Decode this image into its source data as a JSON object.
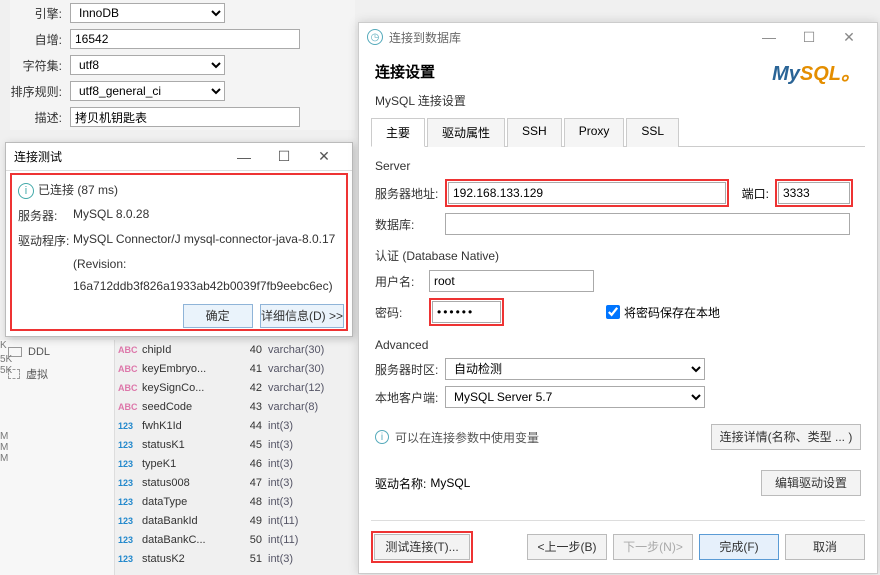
{
  "props": {
    "engine_lbl": "引擎:",
    "engine_val": "InnoDB",
    "auto_lbl": "自增:",
    "auto_val": "16542",
    "charset_lbl": "字符集:",
    "charset_val": "utf8",
    "collation_lbl": "排序规则:",
    "collation_val": "utf8_general_ci",
    "desc_lbl": "描述:",
    "desc_val": "拷贝机钥匙表"
  },
  "test_dialog": {
    "title": "连接测试",
    "connected": "已连接 (87 ms)",
    "server_lbl": "服务器:",
    "server_val": "MySQL 8.0.28",
    "driver_lbl": "驱动程序:",
    "driver_val": "MySQL Connector/J mysql-connector-java-8.0.17",
    "revision_lbl": "(Revision:",
    "revision_val": "16a712ddb3f826a1933ab42b0039f7fb9eebc6ec)",
    "ok_btn": "确定",
    "details_btn": "详细信息(D) >>"
  },
  "side": {
    "ddl_lbl": "DDL",
    "virt_lbl": "虚拟"
  },
  "cols": [
    {
      "icon": "abc",
      "name": "chipId",
      "idx": "40",
      "type": "varchar(30)"
    },
    {
      "icon": "abc",
      "name": "keyEmbryo...",
      "idx": "41",
      "type": "varchar(30)"
    },
    {
      "icon": "abc",
      "name": "keySignCo...",
      "idx": "42",
      "type": "varchar(12)"
    },
    {
      "icon": "abc",
      "name": "seedCode",
      "idx": "43",
      "type": "varchar(8)"
    },
    {
      "icon": "123",
      "name": "fwhK1Id",
      "idx": "44",
      "type": "int(3)"
    },
    {
      "icon": "123",
      "name": "statusK1",
      "idx": "45",
      "type": "int(3)"
    },
    {
      "icon": "123",
      "name": "typeK1",
      "idx": "46",
      "type": "int(3)"
    },
    {
      "icon": "123",
      "name": "status008",
      "idx": "47",
      "type": "int(3)"
    },
    {
      "icon": "123",
      "name": "dataType",
      "idx": "48",
      "type": "int(3)"
    },
    {
      "icon": "123",
      "name": "dataBankId",
      "idx": "49",
      "type": "int(11)"
    },
    {
      "icon": "123",
      "name": "dataBankC...",
      "idx": "50",
      "type": "int(11)"
    },
    {
      "icon": "123",
      "name": "statusK2",
      "idx": "51",
      "type": "int(3)"
    }
  ],
  "conn": {
    "win_title": "连接到数据库",
    "heading": "连接设置",
    "sub": "MySQL 连接设置",
    "logo_my": "My",
    "logo_sql": "SQL",
    "tabs": {
      "main": "主要",
      "driver": "驱动属性",
      "ssh": "SSH",
      "proxy": "Proxy",
      "ssl": "SSL"
    },
    "grp_server": "Server",
    "host_lbl": "服务器地址:",
    "host_val": "192.168.133.129",
    "port_lbl": "端口:",
    "port_val": "3333",
    "db_lbl": "数据库:",
    "grp_auth": "认证 (Database Native)",
    "user_lbl": "用户名:",
    "user_val": "root",
    "pwd_lbl": "密码:",
    "pwd_val": "••••••",
    "save_pwd": "将密码保存在本地",
    "grp_adv": "Advanced",
    "tz_lbl": "服务器时区:",
    "tz_val": "自动检测",
    "client_lbl": "本地客户端:",
    "client_val": "MySQL Server 5.7",
    "note": "可以在连接参数中使用变量",
    "conn_detail_btn": "连接详情(名称、类型 ... )",
    "drv_name_lbl": "驱动名称:",
    "drv_name_val": "MySQL",
    "edit_drv_btn": "编辑驱动设置",
    "test_btn": "测试连接(T)...",
    "back_btn": "<上一步(B)",
    "next_btn": "下一步(N)>",
    "finish_btn": "完成(F)",
    "cancel_btn": "取消"
  }
}
